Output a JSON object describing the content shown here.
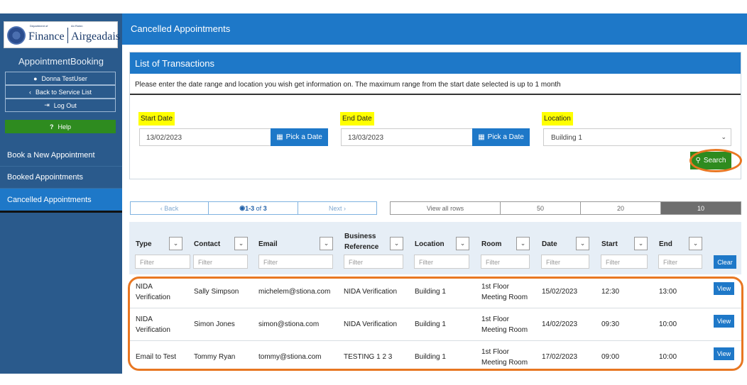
{
  "sidebar": {
    "logo": {
      "dept_small": "Department of",
      "dept_big": "Finance",
      "roinn_small": "An Roinn",
      "roinn_big": "Airgeadais"
    },
    "app_name": "AppointmentBooking",
    "user_name": "Donna TestUser",
    "back_label": "Back to Service List",
    "logout_label": "Log Out",
    "help_label": "Help",
    "nav": [
      {
        "label": "Book a New Appointment"
      },
      {
        "label": "Booked Appointments"
      },
      {
        "label": "Cancelled Appointments"
      }
    ]
  },
  "header": {
    "title": "Cancelled Appointments"
  },
  "panel": {
    "title": "List of Transactions",
    "intro": "Please enter the date range and location you wish get information on. The maximum range from the start date selected is up to 1 month",
    "start_label": "Start Date",
    "start_value": "13/02/2023",
    "end_label": "End Date",
    "end_value": "13/03/2023",
    "pick_label": "Pick a Date",
    "location_label": "Location",
    "location_value": "Building 1",
    "search_label": "Search"
  },
  "pager": {
    "back": "Back",
    "range": "1-3",
    "of_text": "of",
    "total": "3",
    "next": "Next"
  },
  "page_size": {
    "view_all": "View all rows",
    "options": [
      "50",
      "20",
      "10"
    ],
    "selected": "10"
  },
  "table": {
    "filter_placeholder": "Filter",
    "clear_label": "Clear",
    "view_label": "View",
    "columns": [
      "Type",
      "Contact",
      "Email",
      "Business Reference",
      "Location",
      "Room",
      "Date",
      "Start",
      "End"
    ],
    "rows": [
      {
        "type": "NIDA Verification",
        "contact": "Sally Simpson",
        "email": "michelem@stiona.com",
        "ref": "NIDA Verification",
        "location": "Building 1",
        "room": "1st Floor Meeting Room",
        "date": "15/02/2023",
        "start": "12:30",
        "end": "13:00"
      },
      {
        "type": "NIDA Verification",
        "contact": "Simon Jones",
        "email": "simon@stiona.com",
        "ref": "NIDA Verification",
        "location": "Building 1",
        "room": "1st Floor Meeting Room",
        "date": "14/02/2023",
        "start": "09:30",
        "end": "10:00"
      },
      {
        "type": "Email to Test",
        "contact": "Tommy Ryan",
        "email": "tommy@stiona.com",
        "ref": "TESTING 1 2 3",
        "location": "Building 1",
        "room": "1st Floor Meeting Room",
        "date": "17/02/2023",
        "start": "09:00",
        "end": "10:00"
      }
    ]
  },
  "colors": {
    "primary": "#1e78c8",
    "sidebar": "#2a5a8c",
    "success": "#2e8b1f",
    "highlight": "#ffff00",
    "annotation": "#e87722"
  }
}
